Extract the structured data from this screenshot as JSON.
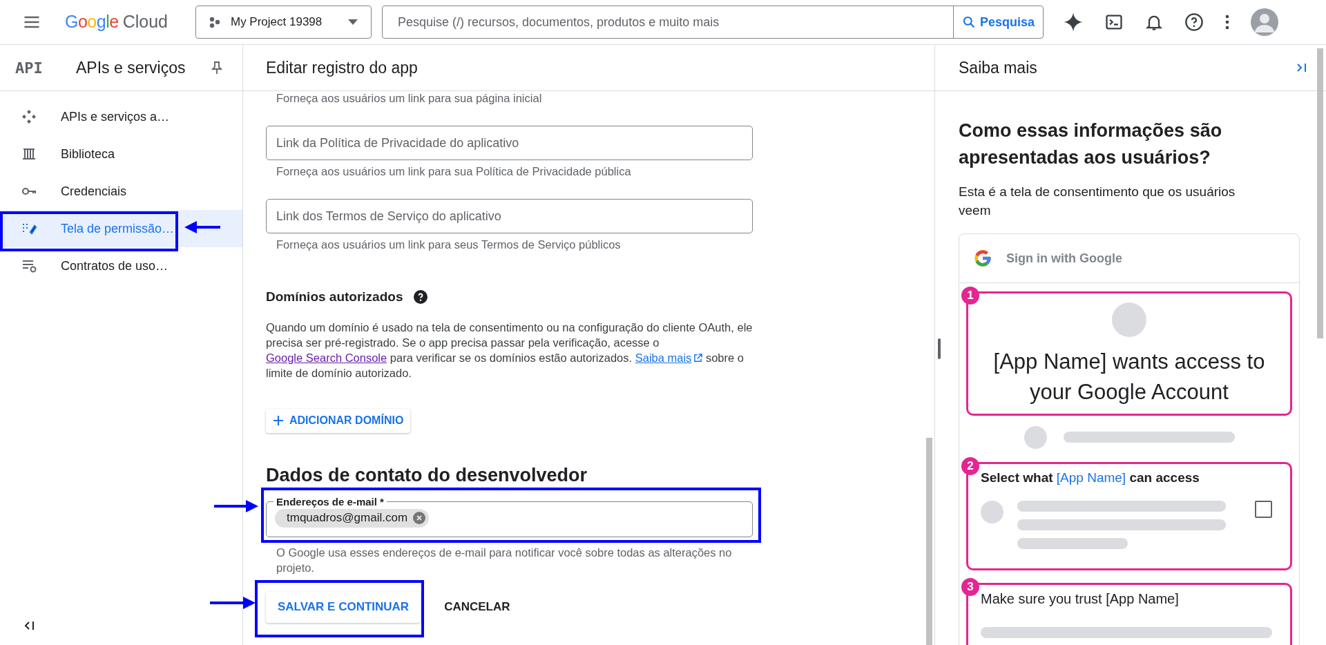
{
  "top_bar": {
    "product_google": "Google",
    "product_cloud": "Cloud",
    "project": "My Project 19398",
    "search_placeholder": "Pesquise (/) recursos, documentos, produtos e muito mais",
    "search_button": "Pesquisa"
  },
  "sidebar": {
    "logo": "API",
    "title": "APIs e serviços",
    "items": [
      {
        "label": "APIs e serviços a…",
        "selected": false
      },
      {
        "label": "Biblioteca",
        "selected": false
      },
      {
        "label": "Credenciais",
        "selected": false
      },
      {
        "label": "Tela de permissão…",
        "selected": true
      },
      {
        "label": "Contratos de uso…",
        "selected": false
      }
    ]
  },
  "main": {
    "title": "Editar registro do app",
    "blocks": [
      {
        "kind": "helper",
        "text": "Forneça aos usuários um link para sua página inicial"
      },
      {
        "kind": "field",
        "placeholder": "Link da Política de Privacidade do aplicativo",
        "helper": "Forneça aos usuários um link para sua Política de Privacidade pública"
      },
      {
        "kind": "field",
        "placeholder": "Link dos Termos de Serviço do aplicativo",
        "helper": "Forneça aos usuários um link para seus Termos de Serviço públicos"
      },
      {
        "kind": "section_heading",
        "text": "Domínios autorizados"
      },
      {
        "kind": "paragraph",
        "parts": [
          {
            "kind": "text",
            "text": "Quando um domínio é usado na tela de consentimento ou na configuração do cliente OAuth, ele precisa ser pré-registrado. Se o app precisa passar pela verificação, acesse o "
          },
          {
            "kind": "link",
            "text": "Google Search Console",
            "visited": true
          },
          {
            "kind": "text",
            "text": " para verificar se os domínios estão autorizados. "
          },
          {
            "kind": "external_link",
            "text": "Saiba mais",
            "visited": false
          },
          {
            "kind": "text",
            "text": " sobre o limite de domínio autorizado."
          }
        ]
      },
      {
        "kind": "add_button",
        "label": "ADICIONAR DOMÍNIO"
      },
      {
        "kind": "heading",
        "text": "Dados de contato do desenvolvedor"
      },
      {
        "kind": "chip_field",
        "label": "Endereços de e-mail *",
        "chips": [
          "tmquadros@gmail.com"
        ],
        "helper": "O Google usa esses endereços de e-mail para notificar você sobre todas as alterações no projeto."
      },
      {
        "kind": "actions",
        "primary": "SALVAR E CONTINUAR",
        "secondary": "CANCELAR"
      }
    ]
  },
  "learn_panel": {
    "title": "Saiba mais",
    "heading": "Como essas informações são apresentadas aos usuários?",
    "text": "Esta é a tela de consentimento que os usuários veem",
    "preview": {
      "header": "Sign in with Google",
      "steps": [
        {
          "number": "1",
          "kind": "title",
          "text": "[App Name] wants access to your Google Account"
        },
        {
          "number": "2",
          "kind": "scopes",
          "before": "Select what ",
          "highlight": "[App Name]",
          "after": " can access",
          "checked": false
        },
        {
          "number": "3",
          "kind": "trust",
          "text": "Make sure you trust [App Name]"
        }
      ]
    }
  }
}
